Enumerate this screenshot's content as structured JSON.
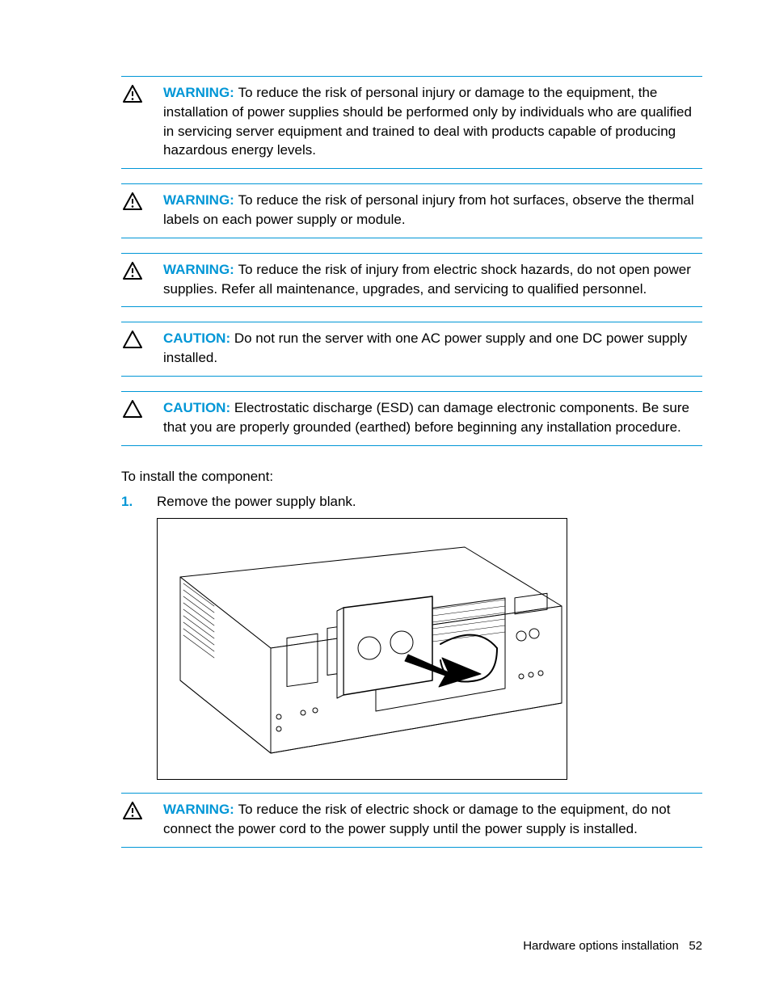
{
  "callouts": [
    {
      "type": "warning",
      "label": "WARNING:",
      "text": "To reduce the risk of personal injury or damage to the equipment, the installation of power supplies should be performed only by individuals who are qualified in servicing server equipment and trained to deal with products capable of producing hazardous energy levels."
    },
    {
      "type": "warning",
      "label": "WARNING:",
      "text": "To reduce the risk of personal injury from hot surfaces, observe the thermal labels on each power supply or module."
    },
    {
      "type": "warning",
      "label": "WARNING:",
      "text": "To reduce the risk of injury from electric shock hazards, do not open power supplies. Refer all maintenance, upgrades, and servicing to qualified personnel."
    },
    {
      "type": "caution",
      "label": "CAUTION:",
      "text": "Do not run the server with one AC power supply and one DC power supply installed."
    },
    {
      "type": "caution",
      "label": "CAUTION:",
      "text": "Electrostatic discharge (ESD) can damage electronic components. Be sure that you are properly grounded (earthed) before beginning any installation procedure."
    }
  ],
  "instruction_intro": "To install the component:",
  "steps": [
    {
      "num": "1.",
      "text": "Remove the power supply blank."
    }
  ],
  "callouts2": [
    {
      "type": "warning",
      "label": "WARNING:",
      "text": "To reduce the risk of electric shock or damage to the equipment, do not connect the power cord to the power supply until the power supply is installed."
    }
  ],
  "footer": {
    "section": "Hardware options installation",
    "page": "52"
  }
}
